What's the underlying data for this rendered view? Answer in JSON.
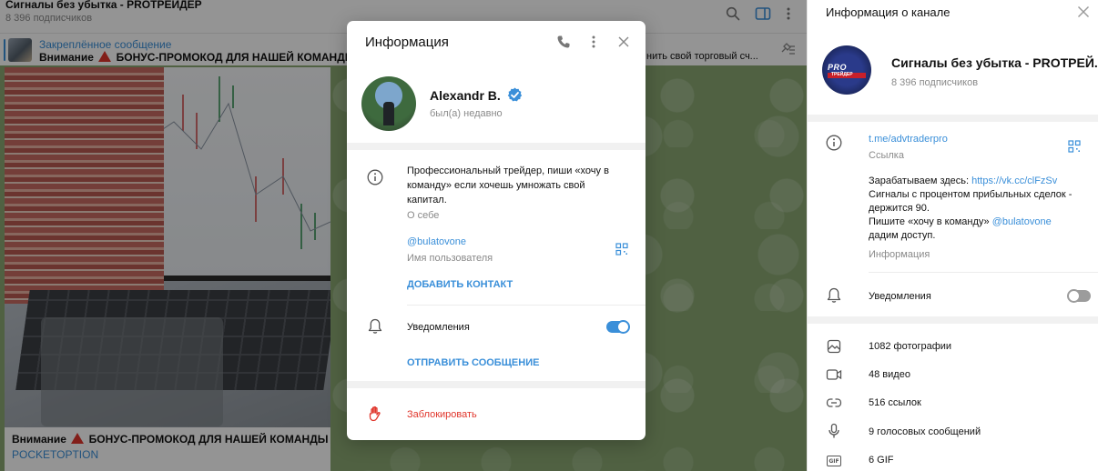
{
  "chat": {
    "title": "Сигналы без убытка - PROTРЕЙДЕР",
    "subscribers": "8 396 подписчиков",
    "pinned": {
      "label": "Закреплённое сообщение",
      "text_prefix": "Внимание",
      "text_suffix": "БОНУС-ПРОМОКОД ДЛЯ НАШЕЙ КОМАНДЫ НА Р",
      "text_right": "нить свой торговый сч..."
    },
    "message": {
      "caption_prefix": "Внимание",
      "caption_suffix": "БОНУС-ПРОМОКОД ДЛЯ НАШЕЙ КОМАНДЫ НА",
      "caption_link": "POCKETOPTION"
    }
  },
  "modal": {
    "title": "Информация",
    "user_name": "Alexandr B.",
    "status": "был(а) недавно",
    "bio": "Профессиональный трейдер, пиши «хочу в команду» если хочешь умножать свой капитал.",
    "bio_label": "О себе",
    "username": "@bulatovone",
    "username_label": "Имя пользователя",
    "add_contact": "ДОБАВИТЬ КОНТАКТ",
    "notifications": "Уведомления",
    "notifications_on": true,
    "send_message": "ОТПРАВИТЬ СООБЩЕНИЕ",
    "block": "Заблокировать"
  },
  "panel": {
    "title": "Информация о канале",
    "channel_name": "Сигналы без убытка - PROTРЕЙ...",
    "channel_subs": "8 396 подписчиков",
    "logo_text": "PRO",
    "logo_subtext": "ТРЕЙДЕР",
    "link": "t.me/advtraderpro",
    "link_label": "Ссылка",
    "desc_1": "Зарабатываем здесь: ",
    "desc_1_link": "https://vk.cc/clFzSv",
    "desc_2": "Сигналы с процентом прибыльных сделок - держится 90.",
    "desc_3": "Пишите «хочу в команду» ",
    "desc_3_link": "@bulatovone",
    "desc_4": "дадим доступ.",
    "desc_label": "Информация",
    "notifications": "Уведомления",
    "notifications_on": false,
    "media": {
      "photos": "1082 фотографии",
      "videos": "48 видео",
      "links": "516 ссылок",
      "voice": "9 голосовых сообщений",
      "gif": "6 GIF",
      "gif_icon_text": "GIF"
    }
  },
  "colors": {
    "accent": "#3a8fd9",
    "danger": "#e0352b",
    "toggle_on": "#3a8fd9",
    "toggle_off": "#9c9c9c",
    "verified": "#3a8fd9"
  }
}
